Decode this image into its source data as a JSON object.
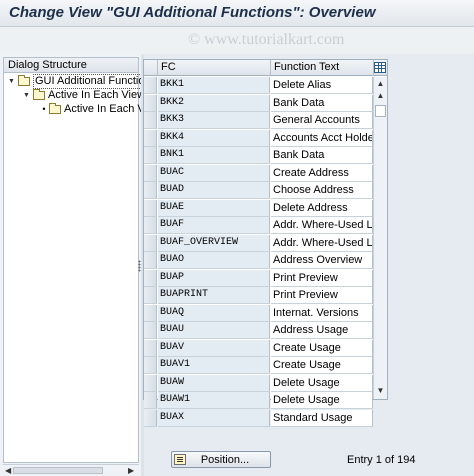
{
  "window": {
    "title": "Change View \"GUI Additional Functions\": Overview",
    "watermark": "© www.tutorialkart.com"
  },
  "dialog_structure": {
    "header": "Dialog Structure",
    "nodes": [
      {
        "label": "GUI Additional Functions",
        "level": 0,
        "selected": true
      },
      {
        "label": "Active In Each View",
        "level": 1,
        "selected": false
      },
      {
        "label": "Active In Each Vi",
        "level": 2,
        "selected": false
      }
    ]
  },
  "table": {
    "columns": [
      "FC",
      "Function Text"
    ],
    "rows": [
      {
        "fc": "BKK1",
        "text": "Delete Alias"
      },
      {
        "fc": "BKK2",
        "text": "Bank Data"
      },
      {
        "fc": "BKK3",
        "text": "General Accounts"
      },
      {
        "fc": "BKK4",
        "text": "Accounts Acct Holder"
      },
      {
        "fc": "BNK1",
        "text": "Bank Data"
      },
      {
        "fc": "BUAC",
        "text": "Create Address"
      },
      {
        "fc": "BUAD",
        "text": "Choose Address"
      },
      {
        "fc": "BUAE",
        "text": "Delete Address"
      },
      {
        "fc": "BUAF",
        "text": "Addr. Where-Used Lst"
      },
      {
        "fc": "BUAF_OVERVIEW",
        "text": "Addr. Where-Used Lst"
      },
      {
        "fc": "BUAO",
        "text": "Address Overview"
      },
      {
        "fc": "BUAP",
        "text": "Print Preview"
      },
      {
        "fc": "BUAPRINT",
        "text": "Print Preview"
      },
      {
        "fc": "BUAQ",
        "text": "Internat. Versions"
      },
      {
        "fc": "BUAU",
        "text": "Address Usage"
      },
      {
        "fc": "BUAV",
        "text": "Create Usage"
      },
      {
        "fc": "BUAV1",
        "text": "Create Usage"
      },
      {
        "fc": "BUAW",
        "text": "Delete Usage"
      },
      {
        "fc": "BUAW1",
        "text": "Delete Usage"
      },
      {
        "fc": "BUAX",
        "text": "Standard Usage"
      }
    ]
  },
  "footer": {
    "position_button": "Position...",
    "entry_info": "Entry 1 of 194"
  }
}
